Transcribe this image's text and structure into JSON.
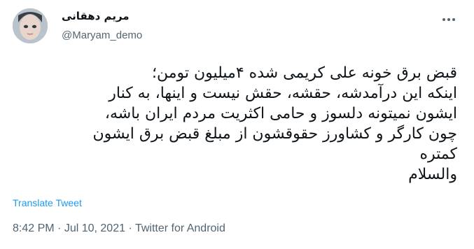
{
  "tweet": {
    "author": {
      "display_name": "مریم دهقانی",
      "username": "@Maryam_demo",
      "avatar_icon": "user-avatar"
    },
    "more_icon": "more-horizontal-icon",
    "text_lines": [
      "قبض برق خونه علی کریمی شده ۴میلیون تومن؛",
      "اینکه این درآمدشه، حقشه، حقش نیست و اینها، به کنار",
      "ایشون نمیتونه دلسوز و حامی اکثریت مردم ایران باشه،",
      "چون کارگر و کشاورز حقوقشون از مبلغ قبض برق ایشون",
      "کمتره",
      "والسلام"
    ],
    "translate_label": "Translate Tweet",
    "meta": {
      "time": "8:42 PM",
      "separator": " · ",
      "date": "Jul 10, 2021",
      "source": "Twitter for Android"
    }
  },
  "colors": {
    "text_primary": "#0f1419",
    "text_secondary": "#536471",
    "link": "#1d9bf0"
  }
}
